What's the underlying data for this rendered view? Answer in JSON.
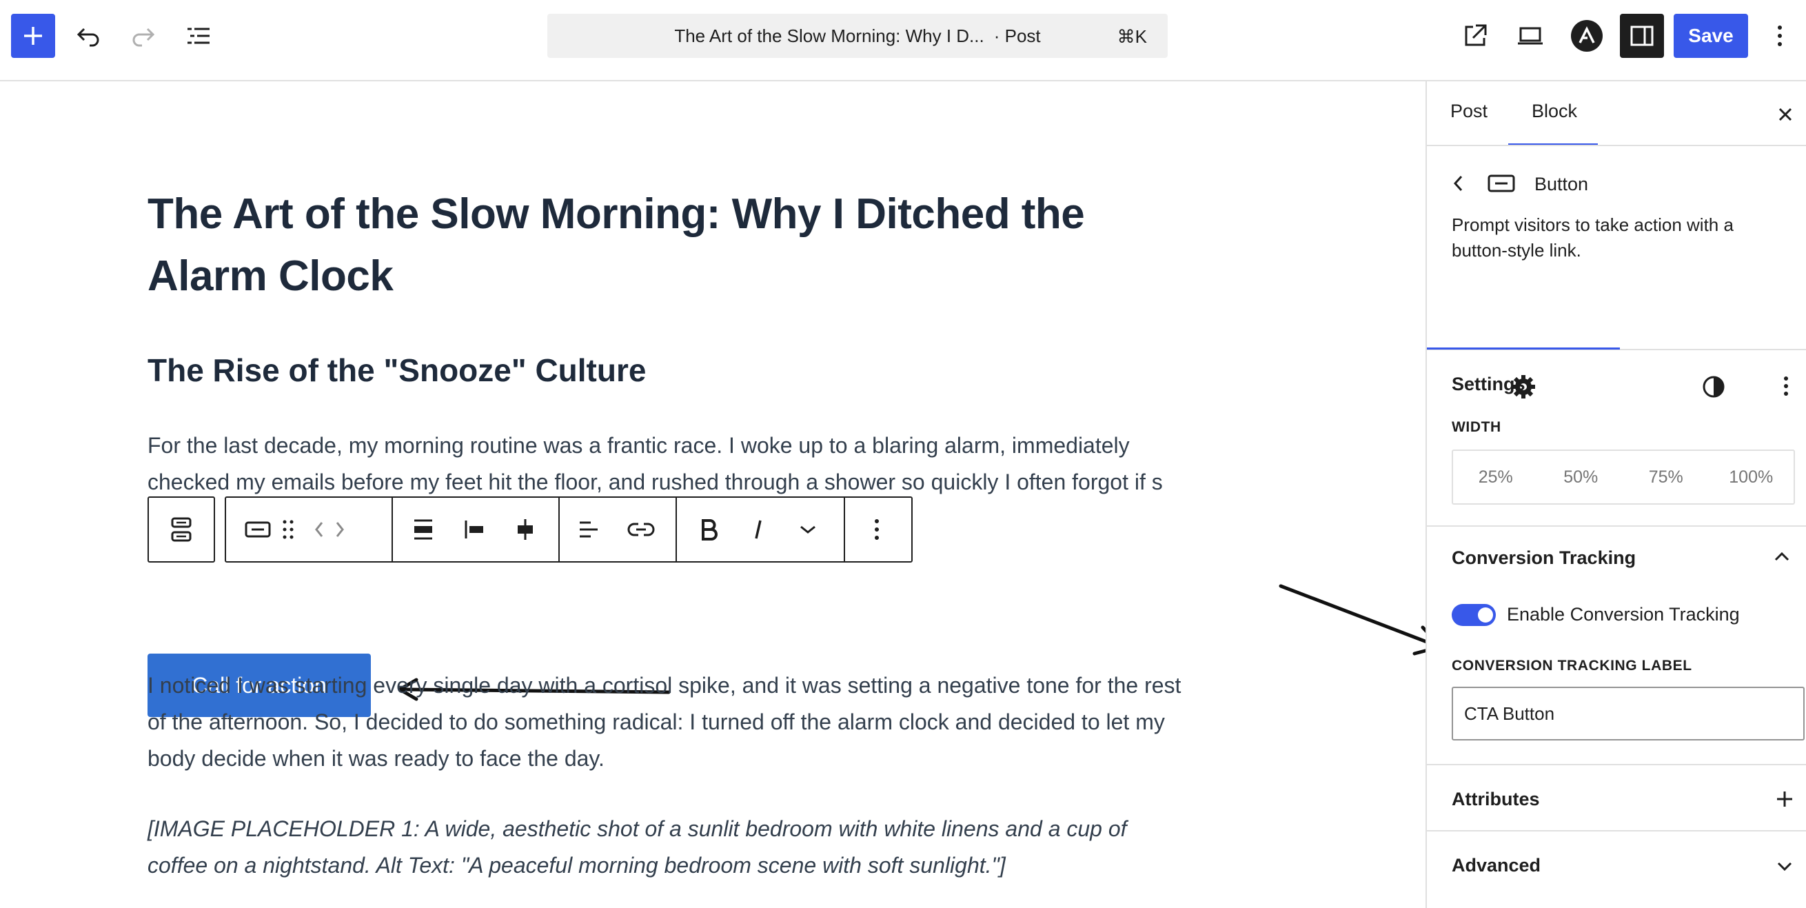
{
  "topbar": {
    "document_title": "The Art of the Slow Morning: Why I D...",
    "document_type": "· Post",
    "shortcut": "⌘K",
    "save_label": "Save",
    "accent_color": "#3858e9"
  },
  "editor": {
    "post_title": "The Art of the Slow Morning: Why I Ditched the Alarm Clock",
    "heading": "The Rise of the \"Snooze\" Culture",
    "paragraph_1": "For the last decade, my morning routine was a frantic race. I woke up to a blaring alarm, immediately checked my emails before my feet hit the floor, and rushed through a shower so quickly I often forgot if s",
    "cta_button_text": "Call for action",
    "cta_color": "#3170d2",
    "paragraph_2": "I noticed I was starting every single day with a cortisol spike, and it was setting a negative tone for the rest of the afternoon. So, I decided to do something radical: I turned off the alarm clock and decided to let my body decide when it was ready to face the day.",
    "paragraph_3": "[IMAGE PLACEHOLDER 1: A wide, aesthetic shot of a sunlit bedroom with white linens and a cup of coffee on a nightstand. Alt Text: \"A peaceful morning bedroom scene with soft sunlight.\"]"
  },
  "sidebar": {
    "tabs": [
      {
        "label": "Post",
        "active": false
      },
      {
        "label": "Block",
        "active": true
      }
    ],
    "block_name": "Button",
    "block_description": "Prompt visitors to take action with a button-style link.",
    "settings_label": "Settings",
    "width_label": "WIDTH",
    "width_options": [
      "25%",
      "50%",
      "75%",
      "100%"
    ],
    "conversion_panel_title": "Conversion Tracking",
    "enable_tracking_label": "Enable Conversion Tracking",
    "enable_tracking_on": true,
    "tracking_label_caption": "CONVERSION TRACKING LABEL",
    "tracking_label_value": "CTA Button",
    "attributes_label": "Attributes",
    "advanced_label": "Advanced"
  }
}
